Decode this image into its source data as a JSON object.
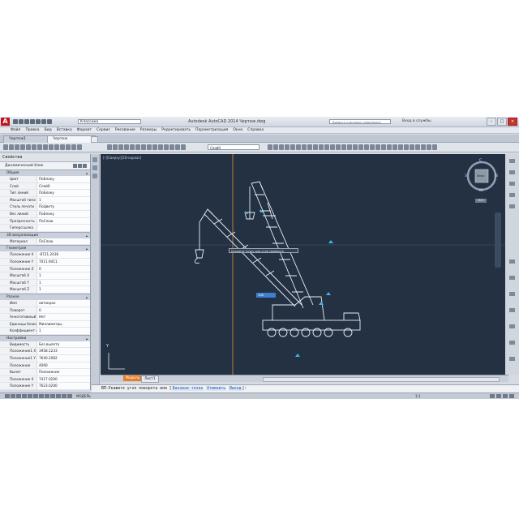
{
  "app": {
    "title": "Autodesk AutoCAD 2014   Чертеж.dwg",
    "workspace": "Классика",
    "help_search_placeholder": "Введите ключевое слово/фразу",
    "login": "Вход в службы",
    "menu": [
      "Файл",
      "Правка",
      "Вид",
      "Вставка",
      "Формат",
      "Сервис",
      "Рисование",
      "Размеры",
      "Редактировать",
      "Параметризация",
      "Окно",
      "Справка"
    ],
    "tabs": [
      "Чертеж1",
      "Чертеж"
    ],
    "layer_combo": "Слой0"
  },
  "properties": {
    "title": "Свойства",
    "selection": "Динамический блок",
    "sections": [
      {
        "name": "Общие",
        "rows": [
          [
            "Цвет",
            "ПоБлоку"
          ],
          [
            "Слой",
            "Слой0"
          ],
          [
            "Тип линий",
            "ПоБлоку"
          ],
          [
            "Масштаб типа линий",
            "1"
          ],
          [
            "Стиль печати",
            "ПоЦвету"
          ],
          [
            "Вес линий",
            "ПоБлоку"
          ],
          [
            "Прозрачность",
            "ПоСлою"
          ],
          [
            "Гиперссылка",
            ""
          ]
        ]
      },
      {
        "name": "3D визуализация",
        "rows": [
          [
            "Материал",
            "ПоСлою"
          ]
        ]
      },
      {
        "name": "Геометрия",
        "rows": [
          [
            "Положение X",
            "-8721.2436"
          ],
          [
            "Положение Y",
            "7011.9411"
          ],
          [
            "Положение Z",
            "0"
          ],
          [
            "Масштаб X",
            "1"
          ],
          [
            "Масштаб Y",
            "1"
          ],
          [
            "Масштаб Z",
            "1"
          ]
        ]
      },
      {
        "name": "Разное",
        "rows": [
          [
            "Имя",
            "автокран"
          ],
          [
            "Поворот",
            "0"
          ],
          [
            "Аннотативный",
            "Нет"
          ],
          [
            "Единицы блока",
            "Миллиметры"
          ],
          [
            "Коэффициент ед.",
            "1"
          ]
        ]
      },
      {
        "name": "Настройки",
        "rows": [
          [
            "Видимость",
            "Без вылета"
          ],
          [
            "Положение1 X",
            "3958.1233"
          ],
          [
            "Положение1 Y",
            "7640.2082"
          ],
          [
            "Положение",
            "4060"
          ],
          [
            "Вылет",
            "Положение"
          ],
          [
            "Положение X",
            "7417.0200"
          ],
          [
            "Положение Y",
            "7623.0200"
          ],
          [
            "Положение Z",
            "1231.4430"
          ]
        ]
      }
    ]
  },
  "viewport": {
    "label": "[-][Сверху][2D-каркас]",
    "tooltip_text": "Укажите точку или угол поворота",
    "input_value": "100",
    "viewcube_labels": {
      "north": "С",
      "south": "Ю",
      "west": "З",
      "east": "В",
      "top": "Верх"
    },
    "wcs_label": "МСК",
    "ucs_y": "Y"
  },
  "layout_tabs": [
    "Модель",
    "Лист1"
  ],
  "command_line": {
    "prompt": "ВП-Укажите угол поворота или",
    "options": [
      "Базовая точка",
      "Отменить",
      "Выход"
    ]
  },
  "status": {
    "model": "МОДЕЛЬ",
    "scale": "1:1"
  }
}
